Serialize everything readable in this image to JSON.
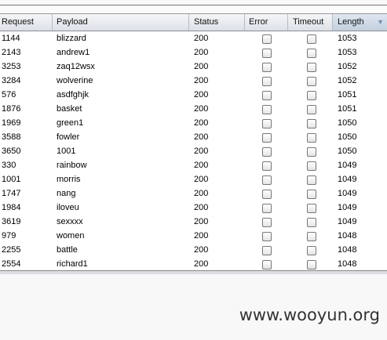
{
  "columns": [
    "Request",
    "Payload",
    "Status",
    "Error",
    "Timeout",
    "Length"
  ],
  "sort": {
    "column": "Length",
    "direction": "descending",
    "icon": "sort-down-arrow-icon"
  },
  "rows": [
    {
      "request": "1144",
      "payload": "blizzard",
      "status": "200",
      "error": false,
      "timeout": false,
      "length": "1053"
    },
    {
      "request": "2143",
      "payload": "andrew1",
      "status": "200",
      "error": false,
      "timeout": false,
      "length": "1053"
    },
    {
      "request": "3253",
      "payload": "zaq12wsx",
      "status": "200",
      "error": false,
      "timeout": false,
      "length": "1052"
    },
    {
      "request": "3284",
      "payload": "wolverine",
      "status": "200",
      "error": false,
      "timeout": false,
      "length": "1052"
    },
    {
      "request": "576",
      "payload": "asdfghjk",
      "status": "200",
      "error": false,
      "timeout": false,
      "length": "1051"
    },
    {
      "request": "1876",
      "payload": "basket",
      "status": "200",
      "error": false,
      "timeout": false,
      "length": "1051"
    },
    {
      "request": "1969",
      "payload": "green1",
      "status": "200",
      "error": false,
      "timeout": false,
      "length": "1050"
    },
    {
      "request": "3588",
      "payload": "fowler",
      "status": "200",
      "error": false,
      "timeout": false,
      "length": "1050"
    },
    {
      "request": "3650",
      "payload": "1001",
      "status": "200",
      "error": false,
      "timeout": false,
      "length": "1050"
    },
    {
      "request": "330",
      "payload": "rainbow",
      "status": "200",
      "error": false,
      "timeout": false,
      "length": "1049"
    },
    {
      "request": "1001",
      "payload": "morris",
      "status": "200",
      "error": false,
      "timeout": false,
      "length": "1049"
    },
    {
      "request": "1747",
      "payload": "nang",
      "status": "200",
      "error": false,
      "timeout": false,
      "length": "1049"
    },
    {
      "request": "1984",
      "payload": "iloveu",
      "status": "200",
      "error": false,
      "timeout": false,
      "length": "1049"
    },
    {
      "request": "3619",
      "payload": "sexxxx",
      "status": "200",
      "error": false,
      "timeout": false,
      "length": "1049"
    },
    {
      "request": "979",
      "payload": "women",
      "status": "200",
      "error": false,
      "timeout": false,
      "length": "1048"
    },
    {
      "request": "2255",
      "payload": "battle",
      "status": "200",
      "error": false,
      "timeout": false,
      "length": "1048"
    },
    {
      "request": "2554",
      "payload": "richard1",
      "status": "200",
      "error": false,
      "timeout": false,
      "length": "1048"
    }
  ],
  "watermark": "www.wooyun.org"
}
